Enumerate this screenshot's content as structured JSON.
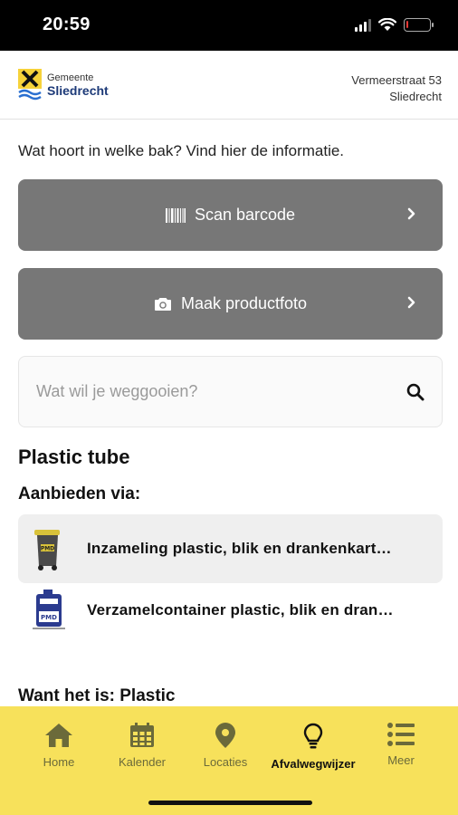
{
  "status": {
    "time": "20:59"
  },
  "header": {
    "logo_small": "Gemeente",
    "logo_big": "Sliedrecht",
    "address_line1": "Vermeerstraat 53",
    "address_line2": "Sliedrecht"
  },
  "intro": "Wat hoort in welke bak? Vind hier de informatie.",
  "actions": {
    "scan_label": "Scan barcode",
    "photo_label": "Maak productfoto"
  },
  "search": {
    "placeholder": "Wat wil je weggooien?",
    "value": ""
  },
  "product": {
    "title": "Plastic tube",
    "offer_heading": "Aanbieden via:",
    "options": [
      {
        "label": "Inzameling plastic, blik en drankenkart…",
        "icon": "pmd-bin-icon",
        "badge": "PMD"
      },
      {
        "label": "Verzamelcontainer plastic, blik en dran…",
        "icon": "pmd-container-icon",
        "badge": "PMD"
      }
    ],
    "category_text": "Want het is: Plastic"
  },
  "nav": {
    "items": [
      {
        "label": "Home",
        "icon": "home-icon"
      },
      {
        "label": "Kalender",
        "icon": "calendar-icon"
      },
      {
        "label": "Locaties",
        "icon": "location-pin-icon"
      },
      {
        "label": "Afvalwegwijzer",
        "icon": "lightbulb-icon",
        "active": true
      },
      {
        "label": "Meer",
        "icon": "menu-list-icon"
      }
    ]
  },
  "colors": {
    "nav_background": "#f7e15b",
    "button_gray": "#777777",
    "logo_blue": "#1d3a78",
    "battery_low": "#e53935"
  },
  "battery_level": 0.1
}
